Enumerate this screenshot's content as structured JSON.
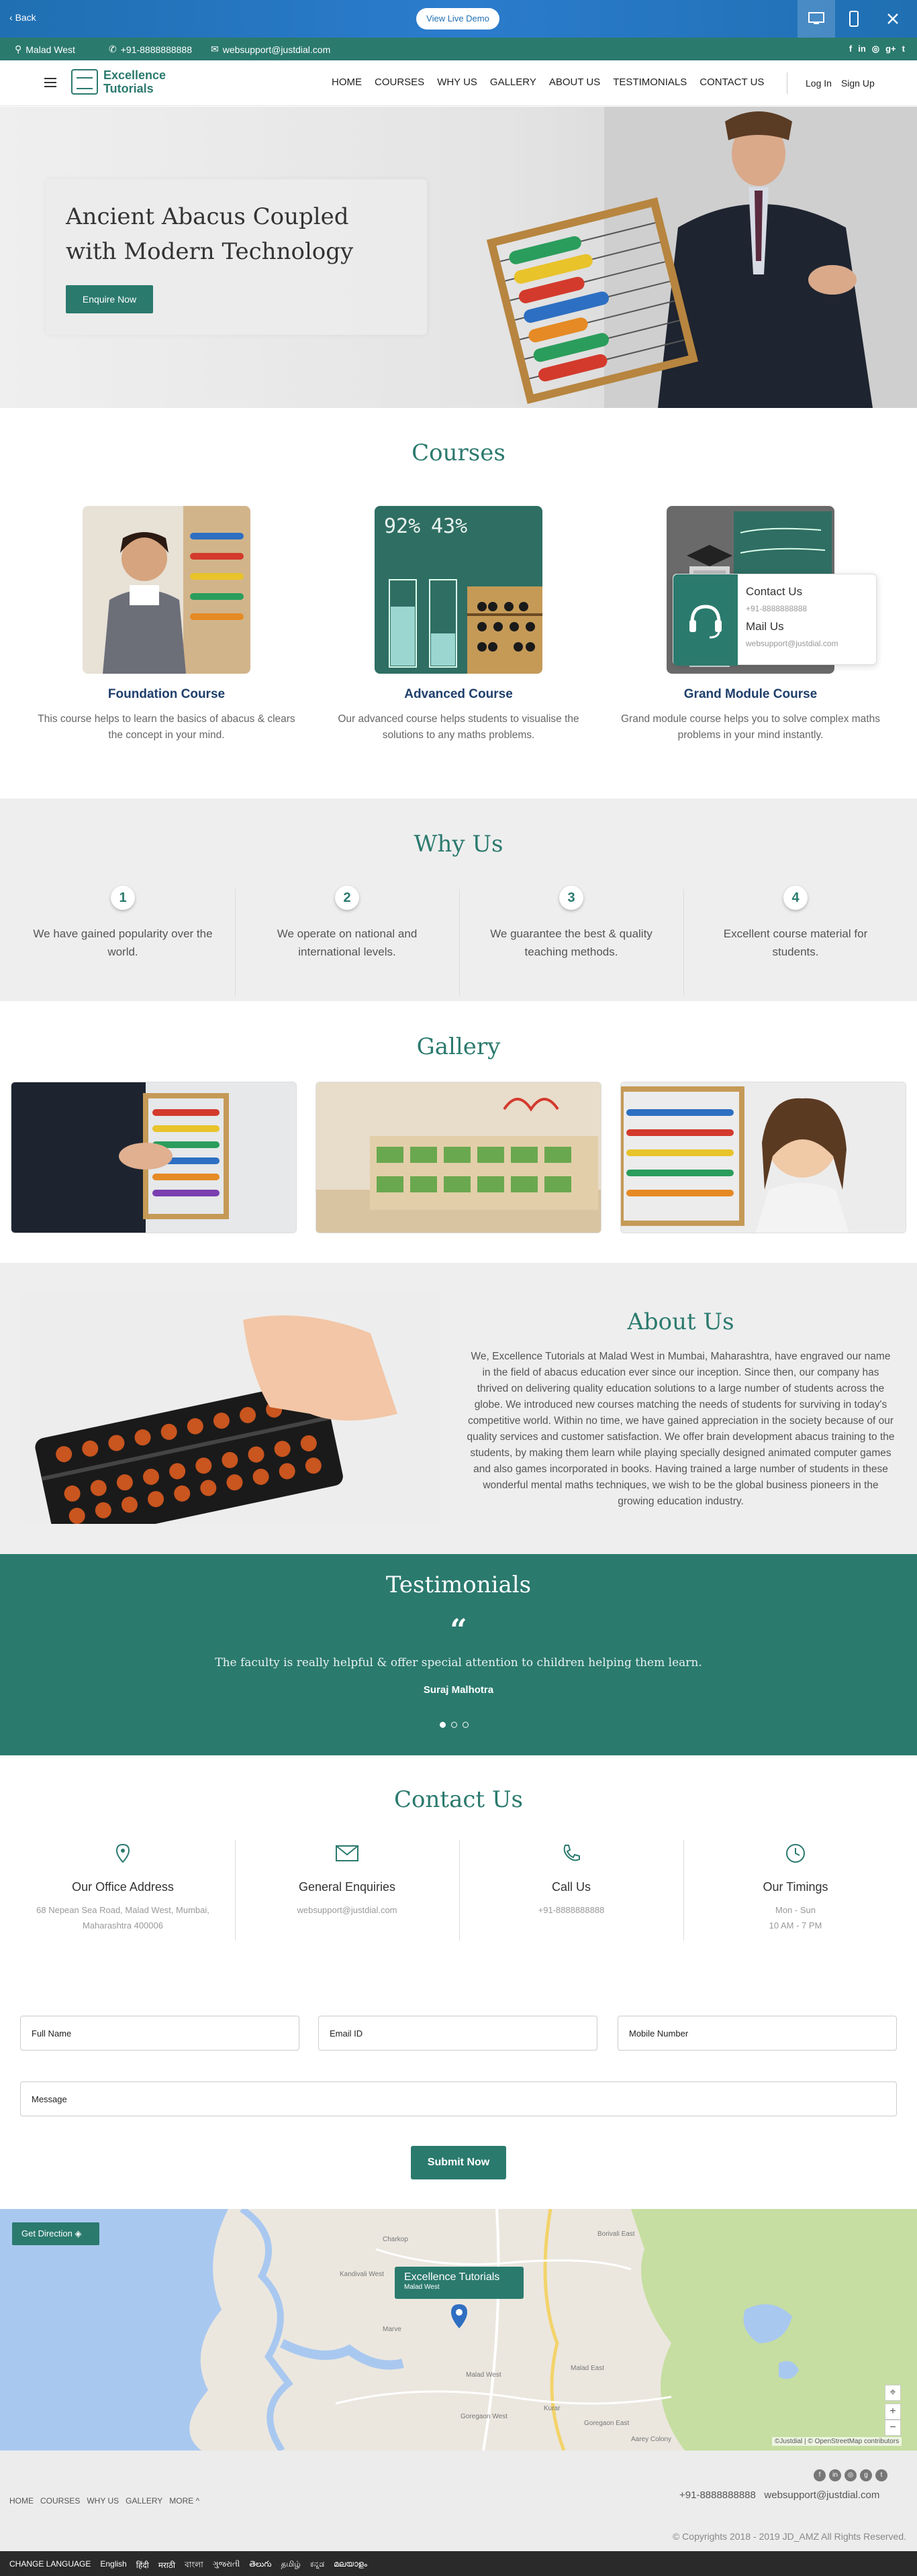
{
  "demo_bar": {
    "back": "Back",
    "live_demo": "View Live Demo"
  },
  "infobar": {
    "location": "Malad West",
    "phone": "+91-8888888888",
    "email": "websupport@justdial.com"
  },
  "header": {
    "logo_line1": "Excellence",
    "logo_line2": "Tutorials",
    "nav": [
      "HOME",
      "COURSES",
      "WHY US",
      "GALLERY",
      "ABOUT US",
      "TESTIMONIALS",
      "CONTACT US"
    ],
    "login": "Log In",
    "signup": "Sign Up"
  },
  "hero": {
    "title": "Ancient Abacus Coupled with Modern Technology",
    "cta": "Enquire Now"
  },
  "courses": {
    "title": "Courses",
    "items": [
      {
        "name": "Foundation Course",
        "desc": "This course helps to learn the basics of abacus & clears the concept in your mind."
      },
      {
        "name": "Advanced Course",
        "desc": "Our advanced course helps students to visualise the solutions to any maths problems."
      },
      {
        "name": "Grand Module Course",
        "desc": "Grand module course helps you to solve complex maths problems in your mind instantly."
      }
    ]
  },
  "contact_popup": {
    "contact_label": "Contact Us",
    "phone": "+91-8888888888",
    "mail_label": "Mail Us",
    "email": "websupport@justdial.com"
  },
  "why_us": {
    "title": "Why Us",
    "items": [
      {
        "num": "1",
        "text": "We have gained popularity over the world."
      },
      {
        "num": "2",
        "text": "We operate on national and international levels."
      },
      {
        "num": "3",
        "text": "We guarantee the best & quality teaching methods."
      },
      {
        "num": "4",
        "text": "Excellent course material for students."
      }
    ]
  },
  "gallery": {
    "title": "Gallery"
  },
  "about": {
    "title": "About Us",
    "text": "We, Excellence Tutorials at Malad West in Mumbai, Maharashtra, have engraved our name in the field of abacus education ever since our inception. Since then, our company has thrived on delivering quality education solutions to a large number of students across the globe. We introduced new courses matching the needs of students for surviving in today's competitive world. Within no time, we have gained appreciation in the society because of our quality services and customer satisfaction. We offer brain development abacus training to the students, by making them learn while playing specially designed animated computer games and also games incorporated in books. Having trained a large number of students in these wonderful mental maths techniques, we wish to be the global business pioneers in the growing education industry."
  },
  "testimonials": {
    "title": "Testimonials",
    "quote_mark": "“",
    "text": "The faculty is really helpful & offer special attention to children helping them learn.",
    "author": "Suraj Malhotra"
  },
  "contact": {
    "title": "Contact Us",
    "items": [
      {
        "heading": "Our Office Address",
        "lines": [
          "68 Nepean Sea Road, Malad West, Mumbai,",
          "Maharashtra 400006"
        ]
      },
      {
        "heading": "General Enquiries",
        "lines": [
          "websupport@justdial.com"
        ]
      },
      {
        "heading": "Call Us",
        "lines": [
          "+91-8888888888"
        ]
      },
      {
        "heading": "Our Timings",
        "lines": [
          "Mon - Sun",
          "10 AM - 7 PM"
        ]
      }
    ],
    "form": {
      "full_name": "Full Name",
      "email": "Email ID",
      "mobile": "Mobile Number",
      "message": "Message",
      "submit": "Submit Now"
    }
  },
  "map": {
    "get_direction": "Get Direction",
    "label_title": "Excellence Tutorials",
    "label_sub": "Malad West",
    "places": [
      "Charkop",
      "Kandivali West",
      "Malad West",
      "Marve",
      "Malad East",
      "Goregaon West",
      "Goregaon East",
      "Borivali East",
      "Kurar",
      "Aarey Colony"
    ],
    "attribution": "©Justdial | © OpenStreetMap contributors"
  },
  "footer": {
    "links": [
      "HOME",
      "COURSES",
      "WHY US",
      "GALLERY",
      "MORE"
    ],
    "phone": "+91-8888888888",
    "email": "websupport@justdial.com",
    "copyright": "© Copyrights 2018 - 2019 JD_AMZ All Rights Reserved.",
    "change_language": "CHANGE LANGUAGE",
    "languages": [
      "English",
      "हिंदी",
      "मराठी",
      "বাংলা",
      "ગુજરાતી",
      "తెలుగు",
      "தமிழ்",
      "ಕನ್ನಡ",
      "മലയാളം"
    ]
  },
  "colors": {
    "primary": "#2b7a6e",
    "demo_bar": "#2b7ccd",
    "course_title": "#1f3f6b"
  }
}
